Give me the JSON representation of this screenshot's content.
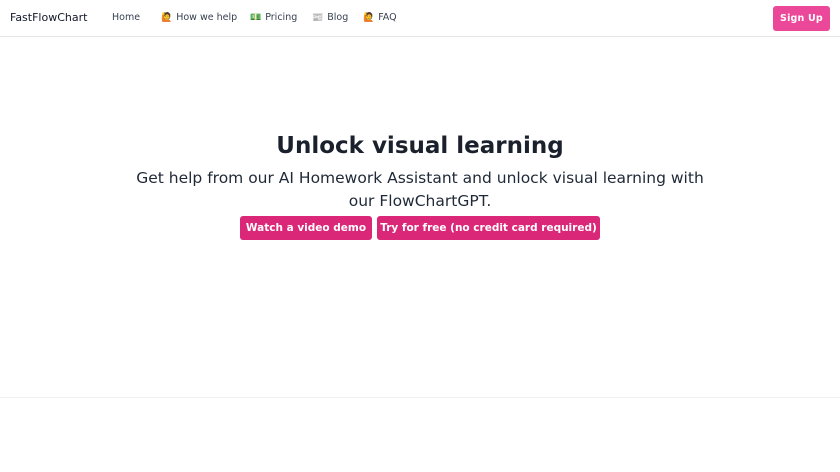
{
  "nav": {
    "brand": "FastFlowChart",
    "links": [
      {
        "icon": "",
        "label": "Home"
      },
      {
        "icon": "🙋",
        "label": "How we help"
      },
      {
        "icon": "💵",
        "label": "Pricing"
      },
      {
        "icon": "📰",
        "label": "Blog"
      },
      {
        "icon": "🙋",
        "label": "FAQ"
      }
    ],
    "signup_label": "Sign Up"
  },
  "hero": {
    "title": "Unlock visual learning",
    "subtitle": "Get help from our AI Homework Assistant and unlock visual learning with our FlowChartGPT.",
    "demo_button": "Watch a video demo",
    "try_button": "Try for free (no credit card required)"
  },
  "colors": {
    "signup": "#ec4899",
    "cta": "#db2777"
  }
}
